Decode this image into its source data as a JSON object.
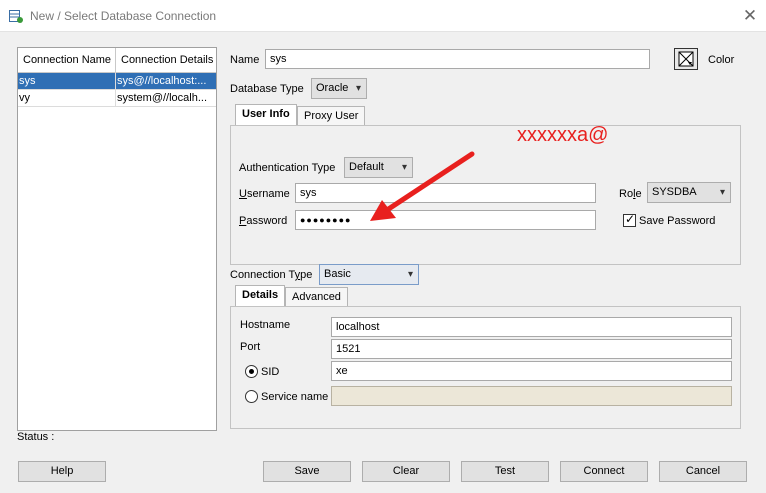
{
  "window": {
    "title": "New / Select Database Connection",
    "close_glyph": "✕"
  },
  "connections": {
    "columns": [
      "Connection Name",
      "Connection Details"
    ],
    "rows": [
      {
        "name": "sys",
        "details": "sys@//localhost:...",
        "selected": true
      },
      {
        "name": "vy",
        "details": "system@//localh...",
        "selected": false
      }
    ]
  },
  "status_label": "Status :",
  "form": {
    "name_label": "Name",
    "name_value": "sys",
    "color_label": "Color",
    "db_type_label": "Database Type",
    "db_type_value": "Oracle",
    "tabs": [
      "User Info",
      "Proxy User"
    ],
    "auth_type_label": "Authentication Type",
    "auth_type_value": "Default",
    "username_label_u": "U",
    "username_label_rest": "sername",
    "username_value": "sys",
    "role_label_pre": "Ro",
    "role_label_u": "l",
    "role_label_rest": "e",
    "role_value": "SYSDBA",
    "password_label_u": "P",
    "password_label_rest": "assword",
    "password_value": "●●●●●●●●",
    "save_password_label": "Save Password",
    "save_password_checked": true,
    "annotation_text": "xxxxxxa@",
    "annotation_color": "#e8201e",
    "conn_type_label_pre": "Connection T",
    "conn_type_label_u": "y",
    "conn_type_label_rest": "pe",
    "conn_type_value": "Basic",
    "details_tabs": [
      "Details",
      "Advanced"
    ],
    "hostname_label": "Hostname",
    "hostname_value": "localhost",
    "port_label": "Port",
    "port_value": "1521",
    "sid_label": "SID",
    "sid_value": "xe",
    "service_name_label": "Service name",
    "service_name_value": ""
  },
  "buttons": {
    "help": "Help",
    "save": "Save",
    "clear": "Clear",
    "test": "Test",
    "connect": "Connect",
    "cancel": "Cancel"
  }
}
